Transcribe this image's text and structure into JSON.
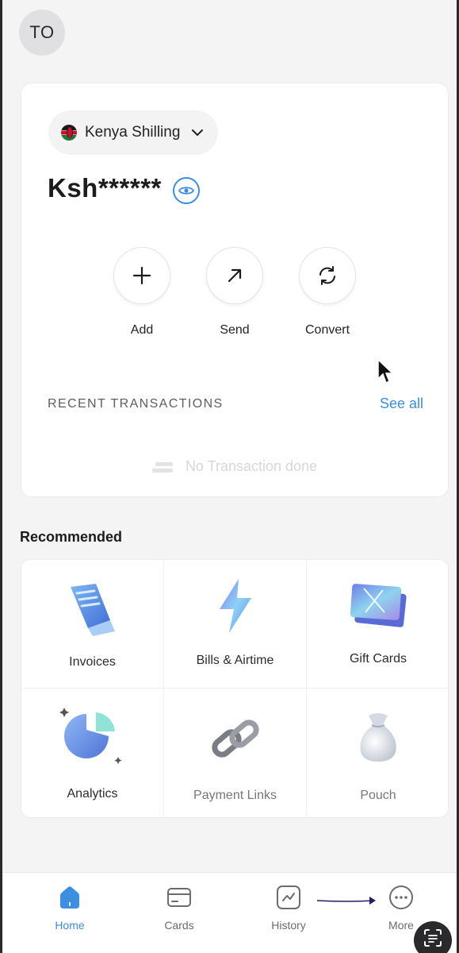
{
  "header": {
    "avatar_initials": "TO"
  },
  "wallet": {
    "currency": "Kenya Shilling",
    "balance_masked": "Ksh******",
    "actions": [
      {
        "label": "Add",
        "icon": "plus-icon"
      },
      {
        "label": "Send",
        "icon": "arrow-up-right-icon"
      },
      {
        "label": "Convert",
        "icon": "refresh-icon"
      }
    ],
    "recent_title": "RECENT TRANSACTIONS",
    "see_all": "See all",
    "empty_text": "No Transaction done"
  },
  "recommended": {
    "title": "Recommended",
    "items": [
      {
        "label": "Invoices",
        "icon": "invoice-icon"
      },
      {
        "label": "Bills & Airtime",
        "icon": "lightning-icon"
      },
      {
        "label": "Gift Cards",
        "icon": "gift-card-icon"
      },
      {
        "label": "Analytics",
        "icon": "pie-chart-icon"
      },
      {
        "label": "Payment Links",
        "icon": "chain-link-icon"
      },
      {
        "label": "Pouch",
        "icon": "money-bag-icon"
      }
    ]
  },
  "nav": {
    "items": [
      {
        "label": "Home",
        "icon": "home-icon",
        "active": true
      },
      {
        "label": "Cards",
        "icon": "card-icon",
        "active": false
      },
      {
        "label": "History",
        "icon": "history-icon",
        "active": false
      },
      {
        "label": "More",
        "icon": "more-icon",
        "active": false
      }
    ]
  },
  "colors": {
    "accent": "#3c8ee0",
    "background": "#f4f4f5",
    "card": "#ffffff",
    "annotation_arrow": "#1f1f6b"
  }
}
